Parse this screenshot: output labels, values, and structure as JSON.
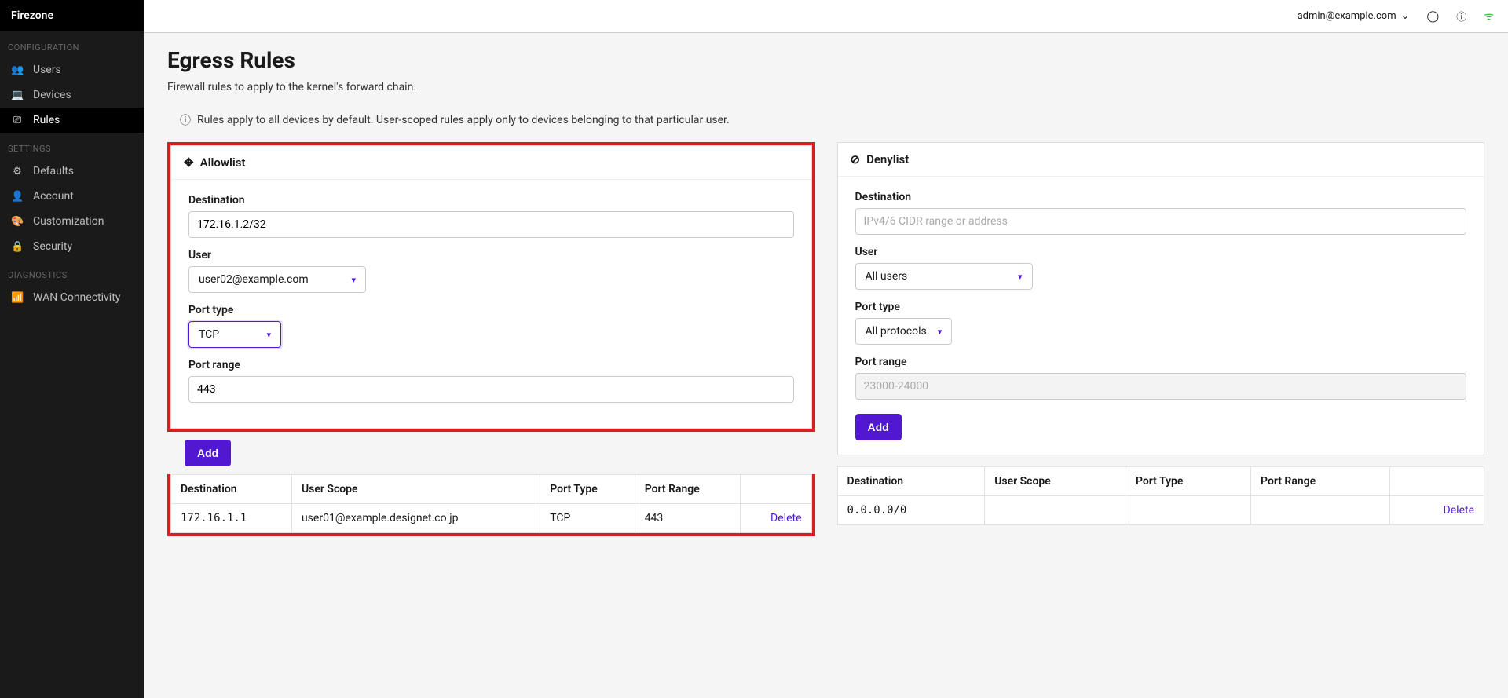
{
  "app_name": "Firezone",
  "topbar": {
    "user_email": "admin@example.com"
  },
  "sidebar": {
    "sections": [
      {
        "label": "CONFIGURATION",
        "items": [
          {
            "icon": "👥",
            "label": "Users"
          },
          {
            "icon": "💻",
            "label": "Devices"
          },
          {
            "icon": "⎚",
            "label": "Rules",
            "active": true
          }
        ]
      },
      {
        "label": "SETTINGS",
        "items": [
          {
            "icon": "⚙",
            "label": "Defaults"
          },
          {
            "icon": "👤",
            "label": "Account"
          },
          {
            "icon": "🎨",
            "label": "Customization"
          },
          {
            "icon": "🔒",
            "label": "Security"
          }
        ]
      },
      {
        "label": "DIAGNOSTICS",
        "items": [
          {
            "icon": "📶",
            "label": "WAN Connectivity"
          }
        ]
      }
    ]
  },
  "page": {
    "title": "Egress Rules",
    "subtitle": "Firewall rules to apply to the kernel's forward chain.",
    "info": "Rules apply to all devices by default. User-scoped rules apply only to devices belonging to that particular user."
  },
  "allowlist": {
    "heading": "Allowlist",
    "destination_label": "Destination",
    "destination_value": "172.16.1.2/32",
    "user_label": "User",
    "user_value": "user02@example.com",
    "porttype_label": "Port type",
    "porttype_value": "TCP",
    "portrange_label": "Port range",
    "portrange_value": "443",
    "add_label": "Add",
    "table": {
      "headers": [
        "Destination",
        "User Scope",
        "Port Type",
        "Port Range",
        ""
      ],
      "rows": [
        {
          "destination": "172.16.1.1",
          "user_scope": "user01@example.designet.co.jp",
          "port_type": "TCP",
          "port_range": "443",
          "action": "Delete"
        }
      ]
    }
  },
  "denylist": {
    "heading": "Denylist",
    "destination_label": "Destination",
    "destination_placeholder": "IPv4/6 CIDR range or address",
    "user_label": "User",
    "user_value": "All users",
    "porttype_label": "Port type",
    "porttype_value": "All protocols",
    "portrange_label": "Port range",
    "portrange_placeholder": "23000-24000",
    "add_label": "Add",
    "table": {
      "headers": [
        "Destination",
        "User Scope",
        "Port Type",
        "Port Range",
        ""
      ],
      "rows": [
        {
          "destination": "0.0.0.0/0",
          "user_scope": "",
          "port_type": "",
          "port_range": "",
          "action": "Delete"
        }
      ]
    }
  }
}
